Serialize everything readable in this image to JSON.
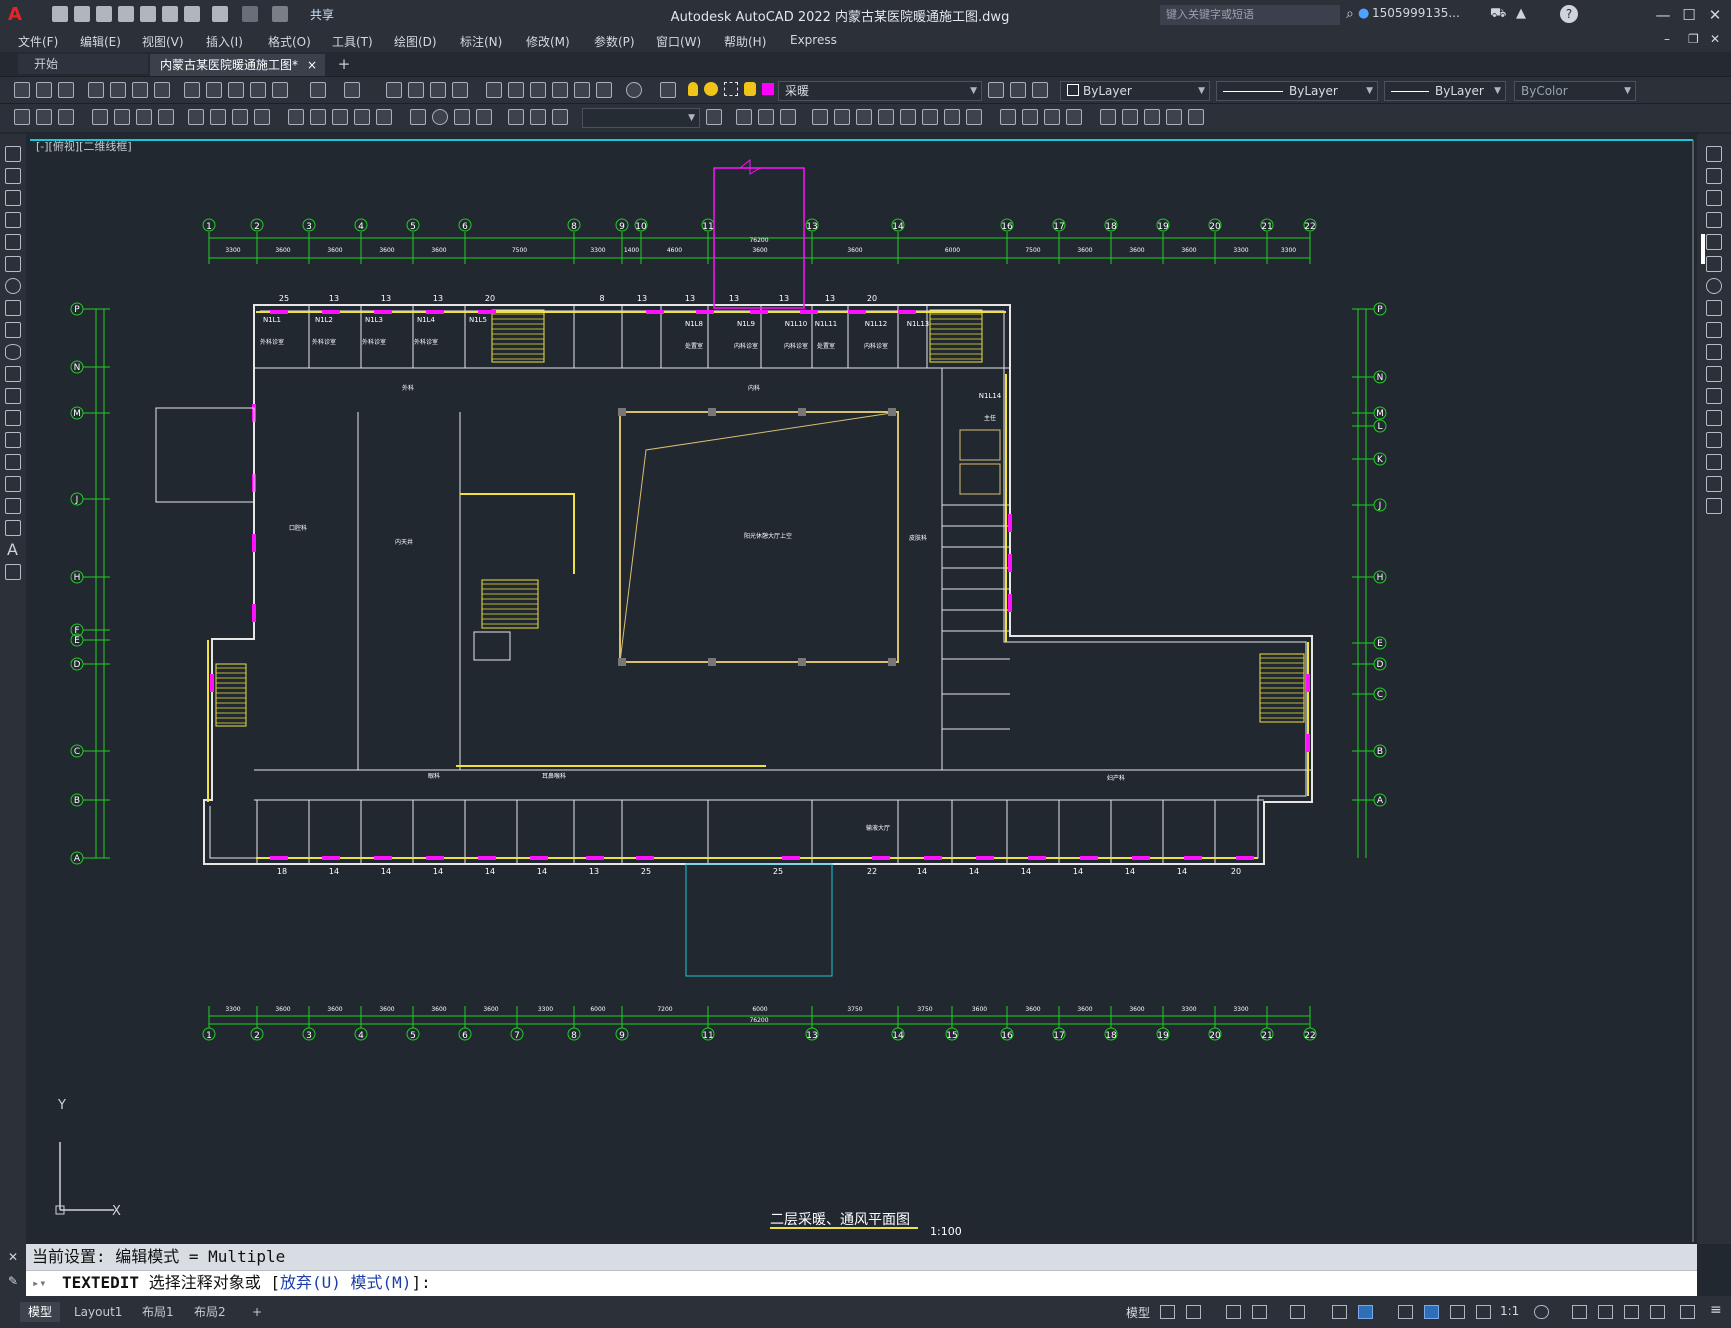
{
  "app": {
    "title": "Autodesk AutoCAD 2022    内蒙古某医院暖通施工图.dwg",
    "share_label": "共享",
    "search_placeholder": "键入关键字或短语",
    "user": "1505999135...",
    "logo_letter": "A"
  },
  "menu": [
    "文件(F)",
    "编辑(E)",
    "视图(V)",
    "插入(I)",
    "格式(O)",
    "工具(T)",
    "绘图(D)",
    "标注(N)",
    "修改(M)",
    "参数(P)",
    "窗口(W)",
    "帮助(H)",
    "Express"
  ],
  "tabs": {
    "start": "开始",
    "document": "内蒙古某医院暖通施工图*",
    "close": "×",
    "add": "+"
  },
  "properties": {
    "layer": "采暖",
    "color": "ByLayer",
    "linetype": "ByLayer",
    "lineweight": "ByLayer",
    "plotstyle": "ByColor",
    "layer_color": "#ff00ff"
  },
  "viewport": {
    "label": "[-][俯视][二维线框]",
    "ucs_x": "X",
    "ucs_y": "Y"
  },
  "drawing": {
    "sheet_title": "二层采暖、通风平面图",
    "scale": "1:100",
    "top_axes": [
      "1",
      "2",
      "3",
      "4",
      "5",
      "6",
      "8",
      "9",
      "10",
      "11",
      "13",
      "14",
      "16",
      "17",
      "18",
      "19",
      "20",
      "21",
      "22"
    ],
    "top_dims": [
      "3300",
      "3600",
      "3600",
      "3600",
      "3600",
      "7500",
      "3300",
      "1400",
      "4600",
      "3600",
      "3600",
      "6000",
      "7500",
      "3600",
      "3600",
      "3600",
      "3300",
      "3300"
    ],
    "top_total": "76200",
    "bottom_axes": [
      "1",
      "2",
      "3",
      "4",
      "5",
      "6",
      "7",
      "8",
      "9",
      "11",
      "13",
      "14",
      "15",
      "16",
      "17",
      "18",
      "19",
      "20",
      "21",
      "22"
    ],
    "bottom_dims": [
      "3300",
      "3600",
      "3600",
      "3600",
      "3600",
      "3600",
      "3300",
      "6000",
      "7200",
      "6000",
      "3750",
      "3750",
      "3600",
      "3600",
      "3600",
      "3600",
      "3300",
      "3300"
    ],
    "bottom_total": "76200",
    "left_axes": [
      "P",
      "N",
      "M",
      "J",
      "H",
      "F",
      "E",
      "D",
      "C",
      "B",
      "A"
    ],
    "right_axes": [
      "P",
      "N",
      "M",
      "L",
      "K",
      "J",
      "H",
      "E",
      "D",
      "C",
      "B",
      "A"
    ],
    "room_labels": [
      {
        "id": "N1L1",
        "name": "外科诊室"
      },
      {
        "id": "N1L2",
        "name": "外科诊室"
      },
      {
        "id": "N1L3",
        "name": "外科诊室"
      },
      {
        "id": "N1L4",
        "name": "外科诊室"
      },
      {
        "id": "N1L5",
        "name": ""
      },
      {
        "id": "N1L8",
        "name": "处置室"
      },
      {
        "id": "N1L9",
        "name": "内科诊室"
      },
      {
        "id": "N1L10",
        "name": "内科诊室"
      },
      {
        "id": "N1L11",
        "name": "处置室"
      },
      {
        "id": "N1L12",
        "name": "内科诊室"
      },
      {
        "id": "N1L13",
        "name": ""
      },
      {
        "id": "N1L14",
        "name": "主任"
      }
    ],
    "area_labels": [
      "外科",
      "内科",
      "阳光休憩大厅上空",
      "皮肤科",
      "口腔科",
      "内天井",
      "妇产科",
      "眼科",
      "耳鼻喉科",
      "输液大厅"
    ],
    "room_numbers_top": [
      "25",
      "13",
      "13",
      "13",
      "20",
      "8",
      "13",
      "13",
      "13",
      "13",
      "13",
      "20"
    ],
    "room_numbers_bottom": [
      "18",
      "14",
      "14",
      "14",
      "14",
      "14",
      "13",
      "25",
      "25",
      "22",
      "14",
      "14",
      "14",
      "14",
      "14",
      "14",
      "20"
    ]
  },
  "command": {
    "history": "当前设置: 编辑模式 = Multiple",
    "prompt_cmd": "TEXTEDIT",
    "prompt_text": "选择注释对象或 [",
    "opt1": "放弃(U)",
    "opt2": "模式(M)",
    "prompt_end": "]:"
  },
  "status": {
    "layout_tabs": [
      "模型",
      "Layout1",
      "布局1",
      "布局2"
    ],
    "add": "+",
    "model_label": "模型",
    "scale": "1:1"
  }
}
